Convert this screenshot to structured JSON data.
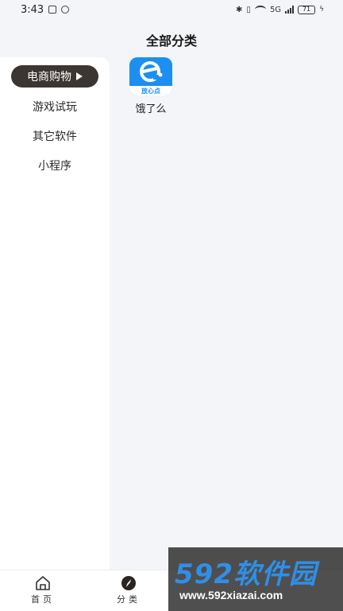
{
  "status_bar": {
    "time": "3:43",
    "network": "5G",
    "battery": "71"
  },
  "header": {
    "title": "全部分类"
  },
  "sidebar": {
    "items": [
      {
        "label": "电商购物",
        "active": true
      },
      {
        "label": "游戏试玩",
        "active": false
      },
      {
        "label": "其它软件",
        "active": false
      },
      {
        "label": "小程序",
        "active": false
      }
    ]
  },
  "apps": [
    {
      "name": "饿了么",
      "icon": "eleme-icon",
      "badge": "放心点",
      "color": "#1c8ff0"
    }
  ],
  "bottom_nav": {
    "items": [
      {
        "label": "首页",
        "icon": "home-icon"
      },
      {
        "label": "分类",
        "icon": "compass-icon"
      }
    ]
  },
  "watermark": {
    "brand": "592软件园",
    "url": "www.592xiazai.com"
  },
  "colors": {
    "background": "#f4f5f9",
    "active_pill": "#3c3633",
    "app_blue": "#1c8ff0"
  }
}
